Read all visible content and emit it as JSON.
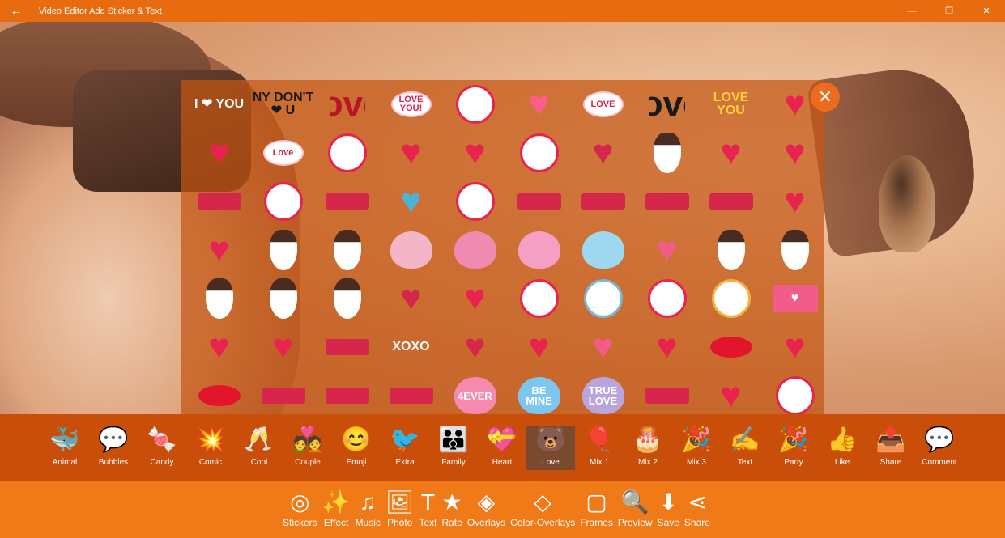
{
  "window": {
    "title": "Video Editor Add Sticker & Text",
    "back_glyph": "←",
    "minimize_glyph": "—",
    "maximize_glyph": "❐",
    "close_glyph": "✕"
  },
  "stickers": [
    {
      "name": "i-love-you",
      "type": "text-s",
      "text": "I ❤ YOU",
      "color": "#ffffff"
    },
    {
      "name": "ny-dont-u",
      "type": "text-s",
      "text": "NY DON'T ❤ U",
      "color": "#1a1a1a"
    },
    {
      "name": "love-script",
      "type": "heart",
      "text": "love",
      "color": "#b81527"
    },
    {
      "name": "love-you-comic",
      "type": "bubble",
      "text": "LOVE YOU!",
      "color": "#e8234f"
    },
    {
      "name": "couple-circle",
      "type": "round",
      "text": "",
      "color": "#e8234f"
    },
    {
      "name": "heart-balloons",
      "type": "heart",
      "text": "♥",
      "color": "#ff5c8a"
    },
    {
      "name": "love-burst",
      "type": "bubble",
      "text": "LOVE",
      "color": "#e8234f"
    },
    {
      "name": "i-love-you-script",
      "type": "heart",
      "text": "I love you",
      "color": "#1a1a1a"
    },
    {
      "name": "love-you-colorful",
      "type": "text-s",
      "text": "LOVE YOU",
      "color": "#ffcf3a"
    },
    {
      "name": "be-my-valentine-heart",
      "type": "heart",
      "text": "♥",
      "color": "#e8234f"
    },
    {
      "name": "valentine-hearts",
      "type": "heart",
      "text": "♥",
      "color": "#e8234f"
    },
    {
      "name": "love-bubble",
      "type": "bubble",
      "text": "Love",
      "color": "#e8234f"
    },
    {
      "name": "vintage-badge",
      "type": "round",
      "text": "",
      "color": "#e8234f"
    },
    {
      "name": "vintage-heart",
      "type": "heart",
      "text": "♥",
      "color": "#e8234f"
    },
    {
      "name": "heart-banner",
      "type": "heart",
      "text": "♥",
      "color": "#e8234f"
    },
    {
      "name": "ribbon-badge",
      "type": "round",
      "text": "",
      "color": "#e8234f"
    },
    {
      "name": "valentines-day-heart",
      "type": "heart",
      "text": "♥",
      "color": "#d7264b"
    },
    {
      "name": "couple-dancing",
      "type": "figure",
      "text": "",
      "color": "#4a2b22"
    },
    {
      "name": "arrow-hearts",
      "type": "heart",
      "text": "♥",
      "color": "#e8234f"
    },
    {
      "name": "true-love-heart",
      "type": "heart",
      "text": "♥",
      "color": "#e8234f"
    },
    {
      "name": "valentines-day-text",
      "type": "banner",
      "text": "",
      "color": "#d7264b"
    },
    {
      "name": "cupcake-badge",
      "type": "round",
      "text": "",
      "color": "#e8234f"
    },
    {
      "name": "all-we-need-is-love",
      "type": "banner",
      "text": "",
      "color": "#d7264b"
    },
    {
      "name": "cupid",
      "type": "heart",
      "text": "♥",
      "color": "#4cb3d4"
    },
    {
      "name": "heart-doily",
      "type": "round",
      "text": "",
      "color": "#e8234f"
    },
    {
      "name": "happy-valentines-day",
      "type": "banner",
      "text": "",
      "color": "#d7264b"
    },
    {
      "name": "valentines-day-ribbon",
      "type": "banner",
      "text": "",
      "color": "#d7264b"
    },
    {
      "name": "valentines-day-script",
      "type": "banner",
      "text": "",
      "color": "#d7264b"
    },
    {
      "name": "i-love-you-banner",
      "type": "banner",
      "text": "",
      "color": "#d7264b"
    },
    {
      "name": "be-my-valentine-heart-2",
      "type": "heart",
      "text": "♥",
      "color": "#e8234f"
    },
    {
      "name": "heart-gift",
      "type": "heart",
      "text": "♥",
      "color": "#e8234f"
    },
    {
      "name": "groom-figure",
      "type": "figure",
      "text": "",
      "color": "#4a2b22"
    },
    {
      "name": "bride-figure",
      "type": "figure",
      "text": "",
      "color": "#4a2b22"
    },
    {
      "name": "wedding-cake",
      "type": "candy",
      "text": "",
      "color": "#f5b5c8"
    },
    {
      "name": "bouquet",
      "type": "candy",
      "text": "",
      "color": "#f08ab0"
    },
    {
      "name": "pink-bird",
      "type": "candy",
      "text": "",
      "color": "#f59fc4"
    },
    {
      "name": "blue-bird",
      "type": "candy",
      "text": "",
      "color": "#9ed7f0"
    },
    {
      "name": "two-hearts",
      "type": "heart",
      "text": "♥",
      "color": "#f25c8a"
    },
    {
      "name": "bride-silhouette",
      "type": "figure",
      "text": "",
      "color": "#4a2b22"
    },
    {
      "name": "couple-silhouette",
      "type": "figure",
      "text": "",
      "color": "#4a2b22"
    },
    {
      "name": "bride-dress",
      "type": "figure",
      "text": "",
      "color": "#4a2b22"
    },
    {
      "name": "couple-embrace",
      "type": "figure",
      "text": "",
      "color": "#4a2b22"
    },
    {
      "name": "couple-kiss",
      "type": "figure",
      "text": "",
      "color": "#4a2b22"
    },
    {
      "name": "save-the-date",
      "type": "heart",
      "text": "♥",
      "color": "#d7264b"
    },
    {
      "name": "save-date-heart",
      "type": "heart",
      "text": "♥",
      "color": "#e8234f"
    },
    {
      "name": "floral-circle",
      "type": "round",
      "text": "",
      "color": "#e8234f"
    },
    {
      "name": "floral-wreath",
      "type": "round",
      "text": "",
      "color": "#7ab6d9"
    },
    {
      "name": "floral-wreath-2",
      "type": "round",
      "text": "",
      "color": "#e8234f"
    },
    {
      "name": "floral-wreath-3",
      "type": "round",
      "text": "",
      "color": "#f2b33d"
    },
    {
      "name": "love-envelope",
      "type": "env",
      "text": "♥",
      "color": "#f25c8a"
    },
    {
      "name": "heart-medal",
      "type": "heart",
      "text": "♥",
      "color": "#e8234f"
    },
    {
      "name": "big-heart",
      "type": "heart",
      "text": "♥",
      "color": "#e8234f"
    },
    {
      "name": "my-heart-belongs",
      "type": "banner",
      "text": "",
      "color": "#d7264b"
    },
    {
      "name": "xoxo",
      "type": "text-s",
      "text": "XOXO",
      "color": "#ffffff"
    },
    {
      "name": "rose",
      "type": "heart",
      "text": "♥",
      "color": "#d7264b"
    },
    {
      "name": "rose-lace",
      "type": "heart",
      "text": "♥",
      "color": "#e8234f"
    },
    {
      "name": "be-mine-heart",
      "type": "heart",
      "text": "♥",
      "color": "#f25c8a"
    },
    {
      "name": "heart-wings",
      "type": "heart",
      "text": "♥",
      "color": "#e8234f"
    },
    {
      "name": "red-lips",
      "type": "lips",
      "text": "",
      "color": "#e3152c"
    },
    {
      "name": "love-red-heart",
      "type": "heart",
      "text": "♥",
      "color": "#e8234f"
    },
    {
      "name": "red-lips-2",
      "type": "lips",
      "text": "",
      "color": "#e3152c"
    },
    {
      "name": "happy-valentines-banner",
      "type": "banner",
      "text": "",
      "color": "#d7264b"
    },
    {
      "name": "valentines-banner-small",
      "type": "banner",
      "text": "",
      "color": "#d7264b"
    },
    {
      "name": "happy-valentines-day-banner",
      "type": "banner",
      "text": "",
      "color": "#d7264b"
    },
    {
      "name": "4ever-candy",
      "type": "candy",
      "text": "4EVER",
      "color": "#f589b0"
    },
    {
      "name": "be-mine-candy",
      "type": "candy",
      "text": "BE MINE",
      "color": "#7dc7ef"
    },
    {
      "name": "true-love-candy",
      "type": "candy",
      "text": "TRUE LOVE",
      "color": "#b9a5dc"
    },
    {
      "name": "valentines-ticket",
      "type": "banner",
      "text": "",
      "color": "#d7264b"
    },
    {
      "name": "heart-drop",
      "type": "heart",
      "text": "♥",
      "color": "#e8234f"
    },
    {
      "name": "be-my-valentine-oval",
      "type": "round",
      "text": "",
      "color": "#e8234f"
    }
  ],
  "close_button_glyph": "✕",
  "categories": [
    {
      "label": "Animal",
      "name": "whale-icon",
      "glyph": "🐳",
      "selected": false
    },
    {
      "label": "Bubbles",
      "name": "hello-bubble-icon",
      "glyph": "💬",
      "selected": false
    },
    {
      "label": "Candy",
      "name": "candy-icon",
      "glyph": "🍬",
      "selected": false
    },
    {
      "label": "Comic",
      "name": "comic-burst-icon",
      "glyph": "💥",
      "selected": false
    },
    {
      "label": "Cool",
      "name": "glasses-icon",
      "glyph": "🥂",
      "selected": false
    },
    {
      "label": "Couple",
      "name": "couple-icon",
      "glyph": "💑",
      "selected": false
    },
    {
      "label": "Emoji",
      "name": "smiley-icon",
      "glyph": "😊",
      "selected": false
    },
    {
      "label": "Extra",
      "name": "bird-icon",
      "glyph": "🐦",
      "selected": false
    },
    {
      "label": "Family",
      "name": "family-icon",
      "glyph": "👪",
      "selected": false
    },
    {
      "label": "Heart",
      "name": "heart-gift-icon",
      "glyph": "💝",
      "selected": false
    },
    {
      "label": "Love",
      "name": "bear-love-icon",
      "glyph": "🐻",
      "selected": true
    },
    {
      "label": "Mix 1",
      "name": "balloons-icon",
      "glyph": "🎈",
      "selected": false
    },
    {
      "label": "Mix 2",
      "name": "cake-icon",
      "glyph": "🎂",
      "selected": false
    },
    {
      "label": "Mix 3",
      "name": "sticker-mix-icon",
      "glyph": "🎉",
      "selected": false
    },
    {
      "label": "Text",
      "name": "text-sticker-icon",
      "glyph": "✍",
      "selected": false
    },
    {
      "label": "Party",
      "name": "party-hat-icon",
      "glyph": "🎉",
      "selected": false
    },
    {
      "label": "Like",
      "name": "thumbs-up-icon",
      "glyph": "👍",
      "selected": false
    },
    {
      "label": "Share",
      "name": "share-app-icon",
      "glyph": "📤",
      "selected": false
    },
    {
      "label": "Comment",
      "name": "comment-icon",
      "glyph": "💬",
      "selected": false
    }
  ],
  "tools": [
    {
      "label": "Stickers",
      "name": "stickers-tool",
      "icon": "sticker-icon",
      "glyph": "◎"
    },
    {
      "label": "Effect",
      "name": "effect-tool",
      "icon": "magic-wand-icon",
      "glyph": "✨"
    },
    {
      "label": "Music",
      "name": "music-tool",
      "icon": "music-note-icon",
      "glyph": "♫"
    },
    {
      "label": "Photo",
      "name": "photo-tool",
      "icon": "photo-icon",
      "glyph": "🖼"
    },
    {
      "label": "Text",
      "name": "text-tool",
      "icon": "text-t-icon",
      "glyph": "T"
    },
    {
      "label": "Rate",
      "name": "rate-tool",
      "icon": "star-icon",
      "glyph": "★"
    },
    {
      "label": "Overlays",
      "name": "overlays-tool",
      "icon": "layers-icon",
      "glyph": "◈"
    },
    {
      "label": "Color-Overlays",
      "name": "color-overlays-tool",
      "icon": "paint-bucket-icon",
      "glyph": "◇"
    },
    {
      "label": "Frames",
      "name": "frames-tool",
      "icon": "frame-icon",
      "glyph": "▢"
    },
    {
      "label": "Preview",
      "name": "preview-tool",
      "icon": "preview-icon",
      "glyph": "🔍"
    },
    {
      "label": "Save",
      "name": "save-tool",
      "icon": "save-icon",
      "glyph": "⬇"
    },
    {
      "label": "Share",
      "name": "share-tool",
      "icon": "share-icon",
      "glyph": "⋖"
    }
  ]
}
